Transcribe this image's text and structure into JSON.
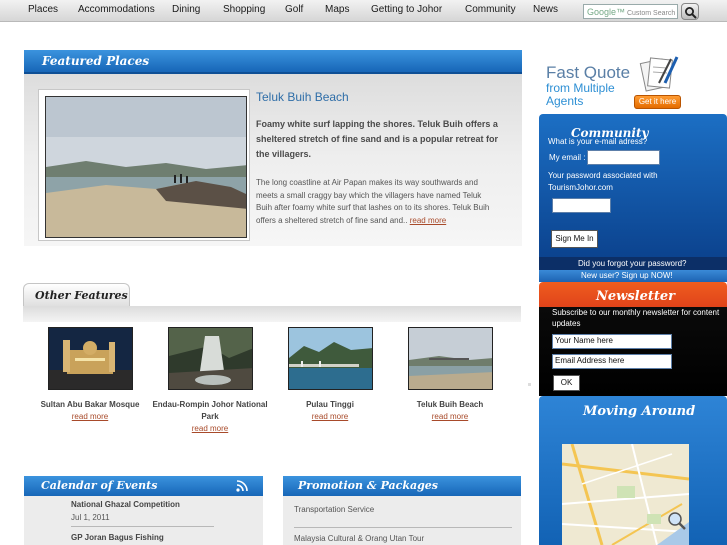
{
  "nav": {
    "items": [
      "Places",
      "Accommodations",
      "Dining",
      "Shopping",
      "Golf",
      "Maps",
      "Getting to Johor",
      "Community",
      "News"
    ],
    "search_brand": "Google™",
    "search_placeholder": "Custom Search"
  },
  "featured": {
    "heading": "Featured Places",
    "title": "Teluk Buih Beach",
    "lead": "Foamy white surf lapping the shores. Teluk Buih offers a sheltered stretch of fine sand and is a popular retreat for the villagers.",
    "body": "The long coastline at Air Papan makes its way southwards and meets a small craggy bay which the villagers have named Teluk Buih after foamy white surf that lashes on to its shores. Teluk Buih offers a sheltered stretch of fine sand and..",
    "read_more": "read more"
  },
  "other_features": {
    "heading": "Other Features",
    "items": [
      {
        "name": "Sultan Abu Bakar Mosque",
        "link": "read more"
      },
      {
        "name": "Endau-Rompin Johor National Park",
        "link": "read more"
      },
      {
        "name": "Pulau Tinggi",
        "link": "read more"
      },
      {
        "name": "Teluk Buih Beach",
        "link": "read more"
      }
    ]
  },
  "calendar": {
    "heading": "Calendar of Events",
    "events": [
      {
        "title": "National Ghazal Competition",
        "date": "Jul 1, 2011"
      },
      {
        "title": "GP Joran Bagus Fishing",
        "date": ""
      }
    ]
  },
  "promotion": {
    "heading": "Promotion & Packages",
    "items": [
      "Transportation Service",
      "Malaysia Cultural & Orang Utan Tour"
    ]
  },
  "fast_quote": {
    "title": "Fast Quote",
    "subtitle": "from Multiple Agents",
    "button": "Get it here"
  },
  "community": {
    "heading": "Community",
    "prompt": "What is your e-mail adress?",
    "email_label": "My email :",
    "email_value": "",
    "password_note": "Your password associated with",
    "site_name": "TourismJohor.com",
    "password_value": "",
    "sign_in": "Sign Me In",
    "forgot": "Did you forgot your password?",
    "signup": "New user? Sign up NOW!"
  },
  "newsletter": {
    "heading": "Newsletter",
    "text": "Subscribe to our monthly newsletter for content updates",
    "name_value": "Your Name here",
    "email_value": "Email Address here",
    "ok": "OK"
  },
  "moving_around": {
    "heading": "Moving Around"
  },
  "colors": {
    "header_blue": "#1766b7",
    "link_red": "#a84a2a",
    "newsletter_orange": "#e0431a",
    "title_blue": "#2f6ea8"
  },
  "icons": [
    "search-icon",
    "rss-icon",
    "quote-icon",
    "zoom-icon"
  ]
}
